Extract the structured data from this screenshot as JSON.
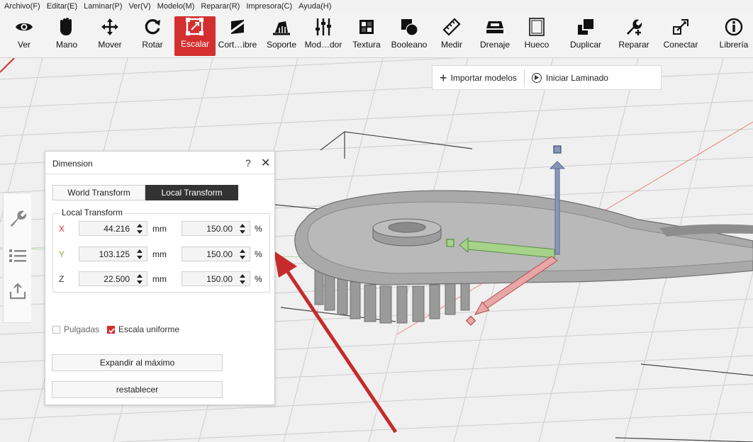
{
  "menu": [
    "Archivo(F)",
    "Editar(E)",
    "Laminar(P)",
    "Ver(V)",
    "Modelo(M)",
    "Reparar(R)",
    "Impresora(C)",
    "Ayuda(H)"
  ],
  "toolbar": {
    "active_color": "#d42f2f",
    "tools": [
      {
        "label": "Ver",
        "icon": "eye-icon"
      },
      {
        "label": "Mano",
        "icon": "hand-icon"
      },
      {
        "label": "Mover",
        "icon": "move-arrows-icon"
      },
      {
        "label": "Rotar",
        "icon": "rotate-icon"
      },
      {
        "label": "Escalar",
        "icon": "scale-icon"
      },
      {
        "label": "Cort…ibre",
        "icon": "cut-icon"
      },
      {
        "label": "Soporte",
        "icon": "support-icon"
      },
      {
        "label": "Mod…dor",
        "icon": "modifier-icon"
      },
      {
        "label": "Textura",
        "icon": "texture-icon"
      },
      {
        "label": "Booleano",
        "icon": "boolean-icon"
      },
      {
        "label": "Medir",
        "icon": "ruler-icon"
      },
      {
        "label": "Drenaje",
        "icon": "drain-icon"
      },
      {
        "label": "Hueco",
        "icon": "hollow-icon"
      },
      {
        "label": "Duplicar",
        "icon": "duplicate-icon"
      },
      {
        "label": "Reparar",
        "icon": "repair-icon"
      },
      {
        "label": "Conectar",
        "icon": "connect-icon"
      },
      {
        "label": "Librería",
        "icon": "library-info-icon"
      }
    ],
    "active_tool": "Escalar"
  },
  "viewport": {
    "import_label": "Importar modelos",
    "slice_label": "Iniciar Laminado"
  },
  "sidepanel": [
    "wrench-icon",
    "list-icon",
    "export-icon"
  ],
  "dialog": {
    "title": "Dimension",
    "help": "?",
    "close": "✕",
    "tabs": {
      "world": "World Transform",
      "local": "Local Transform"
    },
    "group_title": "Local Transform",
    "rows": [
      {
        "axis": "X",
        "axis_color": "#d42f2f",
        "size": "44.216",
        "size_unit": "mm",
        "scale": "150.00",
        "scale_unit": "%"
      },
      {
        "axis": "Y",
        "axis_color": "#7cb342",
        "size": "103.125",
        "size_unit": "mm",
        "scale": "150.00",
        "scale_unit": "%"
      },
      {
        "axis": "Z",
        "axis_color": "#333333",
        "size": "22.500",
        "size_unit": "mm",
        "scale": "150.00",
        "scale_unit": "%"
      }
    ],
    "inches_label": "Pulgadas",
    "inches_checked": false,
    "uniform_label": "Escala uniforme",
    "uniform_checked": true,
    "maximize_label": "Expandir al máximo",
    "reset_label": "restablecer"
  }
}
